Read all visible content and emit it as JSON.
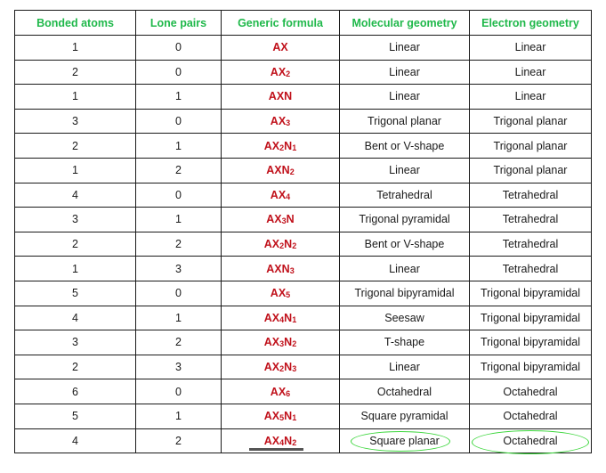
{
  "table": {
    "headers": [
      "Bonded atoms",
      "Lone pairs",
      "Generic formula",
      "Molecular geometry",
      "Electron geometry"
    ],
    "rows": [
      {
        "bonded": "1",
        "lone": "0",
        "formula": [
          [
            "AX",
            ""
          ]
        ],
        "molecular": "Linear",
        "electron": "Linear"
      },
      {
        "bonded": "2",
        "lone": "0",
        "formula": [
          [
            "AX",
            "2"
          ]
        ],
        "molecular": "Linear",
        "electron": "Linear"
      },
      {
        "bonded": "1",
        "lone": "1",
        "formula": [
          [
            "AXN",
            ""
          ]
        ],
        "molecular": "Linear",
        "electron": "Linear"
      },
      {
        "bonded": "3",
        "lone": "0",
        "formula": [
          [
            "AX",
            "3"
          ]
        ],
        "molecular": "Trigonal planar",
        "electron": "Trigonal planar"
      },
      {
        "bonded": "2",
        "lone": "1",
        "formula": [
          [
            "AX",
            "2"
          ],
          [
            "N",
            "1"
          ]
        ],
        "molecular": "Bent or V-shape",
        "electron": "Trigonal planar"
      },
      {
        "bonded": "1",
        "lone": "2",
        "formula": [
          [
            "AXN",
            "2"
          ]
        ],
        "molecular": "Linear",
        "electron": "Trigonal planar"
      },
      {
        "bonded": "4",
        "lone": "0",
        "formula": [
          [
            "AX",
            "4"
          ]
        ],
        "molecular": "Tetrahedral",
        "electron": "Tetrahedral"
      },
      {
        "bonded": "3",
        "lone": "1",
        "formula": [
          [
            "AX",
            "3"
          ],
          [
            "N",
            ""
          ]
        ],
        "molecular": "Trigonal pyramidal",
        "electron": "Tetrahedral"
      },
      {
        "bonded": "2",
        "lone": "2",
        "formula": [
          [
            "AX",
            "2"
          ],
          [
            "N",
            "2"
          ]
        ],
        "molecular": "Bent or V-shape",
        "electron": "Tetrahedral"
      },
      {
        "bonded": "1",
        "lone": "3",
        "formula": [
          [
            "AXN",
            "3"
          ]
        ],
        "molecular": "Linear",
        "electron": "Tetrahedral"
      },
      {
        "bonded": "5",
        "lone": "0",
        "formula": [
          [
            "AX",
            "5"
          ]
        ],
        "molecular": "Trigonal bipyramidal",
        "electron": "Trigonal bipyramidal"
      },
      {
        "bonded": "4",
        "lone": "1",
        "formula": [
          [
            "AX",
            "4"
          ],
          [
            "N",
            "1"
          ]
        ],
        "molecular": "Seesaw",
        "electron": "Trigonal bipyramidal"
      },
      {
        "bonded": "3",
        "lone": "2",
        "formula": [
          [
            "AX",
            "3"
          ],
          [
            "N",
            "2"
          ]
        ],
        "molecular": "T-shape",
        "electron": "Trigonal bipyramidal"
      },
      {
        "bonded": "2",
        "lone": "3",
        "formula": [
          [
            "AX",
            "2"
          ],
          [
            "N",
            "3"
          ]
        ],
        "molecular": "Linear",
        "electron": "Trigonal bipyramidal"
      },
      {
        "bonded": "6",
        "lone": "0",
        "formula": [
          [
            "AX",
            "6"
          ]
        ],
        "molecular": "Octahedral",
        "electron": "Octahedral"
      },
      {
        "bonded": "5",
        "lone": "1",
        "formula": [
          [
            "AX",
            "5"
          ],
          [
            "N",
            "1"
          ]
        ],
        "molecular": "Square pyramidal",
        "electron": "Octahedral"
      },
      {
        "bonded": "4",
        "lone": "2",
        "formula": [
          [
            "AX",
            "4"
          ],
          [
            "N",
            "2"
          ]
        ],
        "molecular": "Square planar",
        "electron": "Octahedral",
        "highlighted": true
      }
    ]
  },
  "colors": {
    "header_text": "#1fb84a",
    "formula_text": "#c0101a",
    "highlight_ellipse": "#3bd63b",
    "underline": "#555555"
  }
}
